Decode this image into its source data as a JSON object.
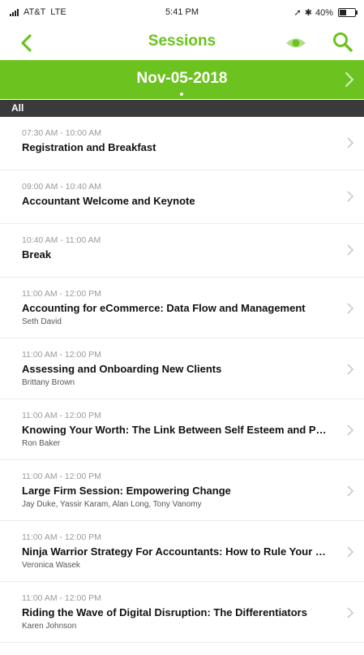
{
  "status_bar": {
    "carrier": "AT&T",
    "network": "LTE",
    "time": "5:41 PM",
    "battery": "40%"
  },
  "header": {
    "title": "Sessions",
    "accent": "#6cc21f"
  },
  "date_bar": {
    "date": "Nov-05-2018"
  },
  "filter": {
    "label": "All"
  },
  "sessions": [
    {
      "time": "07:30 AM - 10:00 AM",
      "title": "Registration and Breakfast",
      "speakers": ""
    },
    {
      "time": "09:00 AM - 10:40 AM",
      "title": "Accountant Welcome and Keynote",
      "speakers": ""
    },
    {
      "time": "10:40 AM - 11:00 AM",
      "title": "Break",
      "speakers": ""
    },
    {
      "time": "11:00 AM - 12:00 PM",
      "title": "Accounting for eCommerce: Data Flow and Management",
      "speakers": "Seth David"
    },
    {
      "time": "11:00 AM - 12:00 PM",
      "title": "Assessing and Onboarding New Clients",
      "speakers": "Brittany Brown"
    },
    {
      "time": "11:00 AM - 12:00 PM",
      "title": "Knowing Your Worth: The Link Between Self Esteem and Pricing",
      "speakers": "Ron Baker"
    },
    {
      "time": "11:00 AM - 12:00 PM",
      "title": "Large Firm Session: Empowering Change",
      "speakers": "Jay Duke, Yassir Karam, Alan Long, Tony Vanomy"
    },
    {
      "time": "11:00 AM - 12:00 PM",
      "title": "Ninja Warrior Strategy For Accountants: How to Rule Your Practice",
      "speakers": "Veronica Wasek"
    },
    {
      "time": "11:00 AM - 12:00 PM",
      "title": "Riding the Wave of Digital Disruption: The Differentiators",
      "speakers": "Karen Johnson"
    }
  ]
}
